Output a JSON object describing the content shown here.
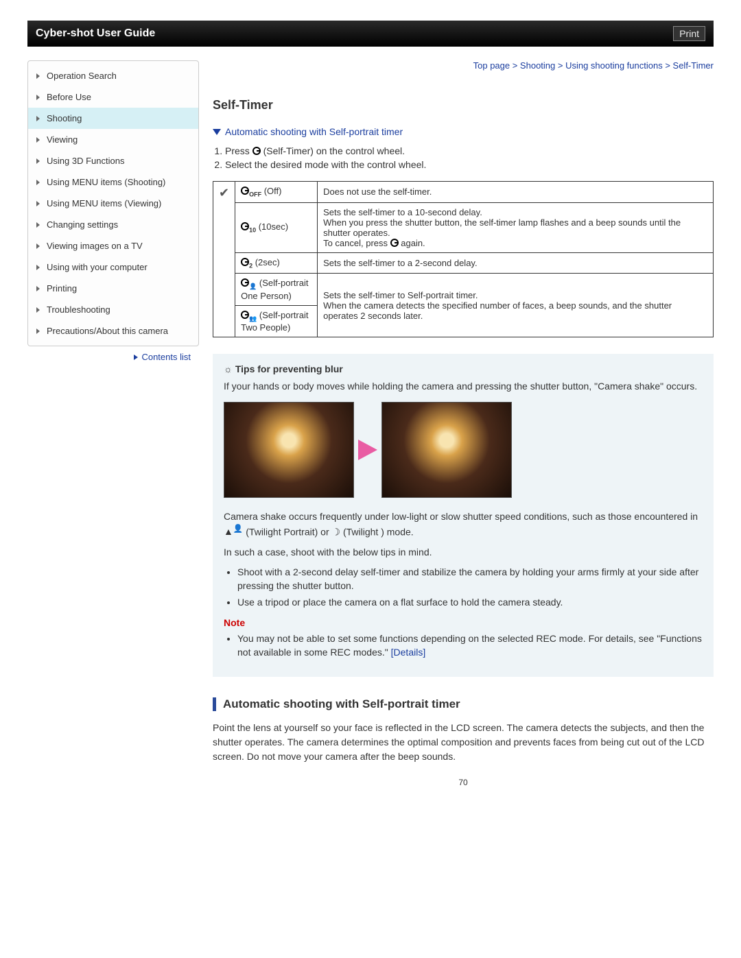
{
  "header": {
    "title": "Cyber-shot User Guide",
    "print": "Print"
  },
  "breadcrumb": "Top page > Shooting > Using shooting functions > Self-Timer",
  "sidebar": {
    "items": [
      {
        "label": "Operation Search",
        "active": false
      },
      {
        "label": "Before Use",
        "active": false
      },
      {
        "label": "Shooting",
        "active": true
      },
      {
        "label": "Viewing",
        "active": false
      },
      {
        "label": "Using 3D Functions",
        "active": false
      },
      {
        "label": "Using MENU items (Shooting)",
        "active": false
      },
      {
        "label": "Using MENU items (Viewing)",
        "active": false
      },
      {
        "label": "Changing settings",
        "active": false
      },
      {
        "label": "Viewing images on a TV",
        "active": false
      },
      {
        "label": "Using with your computer",
        "active": false
      },
      {
        "label": "Printing",
        "active": false
      },
      {
        "label": "Troubleshooting",
        "active": false
      },
      {
        "label": "Precautions/About this camera",
        "active": false
      }
    ],
    "contents_list": "Contents list"
  },
  "page": {
    "heading": "Self-Timer",
    "anchor": "Automatic shooting with Self-portrait timer",
    "step1_a": "Press ",
    "step1_b": " (Self-Timer) on the control wheel.",
    "step2": "Select the desired mode with the control wheel.",
    "table": {
      "r0": {
        "mode_sub": "OFF",
        "mode_txt": " (Off)",
        "desc": "Does not use the self-timer."
      },
      "r1": {
        "mode_sub": "10",
        "mode_txt": " (10sec)",
        "desc_a": "Sets the self-timer to a 10-second delay.",
        "desc_b": "When you press the shutter button, the self-timer lamp flashes and a beep sounds until the shutter operates.",
        "desc_c1": "To cancel, press ",
        "desc_c2": " again."
      },
      "r2": {
        "mode_sub": "2",
        "mode_txt": " (2sec)",
        "desc": "Sets the self-timer to a 2-second delay."
      },
      "r3": {
        "mode_txt": " (Self-portrait One Person)",
        "desc_a": "Sets the self-timer to Self-portrait timer.",
        "desc_b": "When the camera detects the specified number of faces, a beep sounds, and the shutter operates 2 seconds later."
      },
      "r4": {
        "mode_txt": " (Self-portrait Two People)"
      }
    },
    "tips": {
      "heading": "Tips for preventing blur",
      "p1": "If your hands or body moves while holding the camera and pressing the shutter button, \"Camera shake\" occurs.",
      "p2_a": "Camera shake occurs frequently under low-light or slow shutter speed conditions, such as those encountered in ",
      "p2_b": " (Twilight Portrait) or ",
      "p2_c": " (Twilight ) mode.",
      "p3": "In such a case, shoot with the below tips in mind.",
      "bullets": [
        "Shoot with a 2-second delay self-timer and stabilize the camera by holding your arms firmly at your side after pressing the shutter button.",
        "Use a tripod or place the camera on a flat surface to hold the camera steady."
      ],
      "note_label": "Note",
      "note_text_a": "You may not be able to set some functions depending on the selected REC mode. For details, see \"Functions not available in some REC modes.\" ",
      "note_link": "[Details]"
    },
    "section2": {
      "heading": "Automatic shooting with Self-portrait timer",
      "p": "Point the lens at yourself so your face is reflected in the LCD screen. The camera detects the subjects, and then the shutter operates. The camera determines the optimal composition and prevents faces from being cut out of the LCD screen. Do not move your camera after the beep sounds."
    },
    "page_num": "70"
  }
}
